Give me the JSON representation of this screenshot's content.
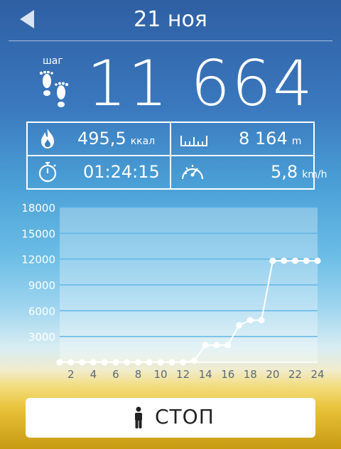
{
  "header": {
    "date": "21 ноя"
  },
  "steps": {
    "label": "шаг",
    "value": "11 664"
  },
  "stats": {
    "calories": {
      "value": "495,5",
      "unit": "ккал"
    },
    "distance": {
      "value": "8 164",
      "unit": "m"
    },
    "duration": {
      "value": "01:24:15"
    },
    "speed": {
      "value": "5,8",
      "unit": "km/h"
    }
  },
  "chart_data": {
    "type": "line",
    "x": [
      1,
      2,
      3,
      4,
      5,
      6,
      7,
      8,
      9,
      10,
      11,
      12,
      13,
      14,
      15,
      16,
      17,
      18,
      19,
      20,
      21,
      22,
      23,
      24
    ],
    "series": [
      {
        "values": [
          0,
          0,
          0,
          0,
          0,
          0,
          0,
          0,
          0,
          0,
          0,
          0,
          200,
          2000,
          2000,
          2000,
          4300,
          4900,
          4900,
          11800,
          11800,
          11800,
          11800,
          11800
        ]
      }
    ],
    "y_ticks": [
      "3000",
      "6000",
      "9000",
      "12000",
      "15000",
      "18000"
    ],
    "y_top_label": "18000",
    "x_ticks": [
      "2",
      "4",
      "6",
      "8",
      "10",
      "12",
      "14",
      "16",
      "18",
      "20",
      "22",
      "24"
    ],
    "ylim": [
      0,
      18000
    ],
    "grid": true
  },
  "action_button": {
    "label": "СТОП"
  }
}
